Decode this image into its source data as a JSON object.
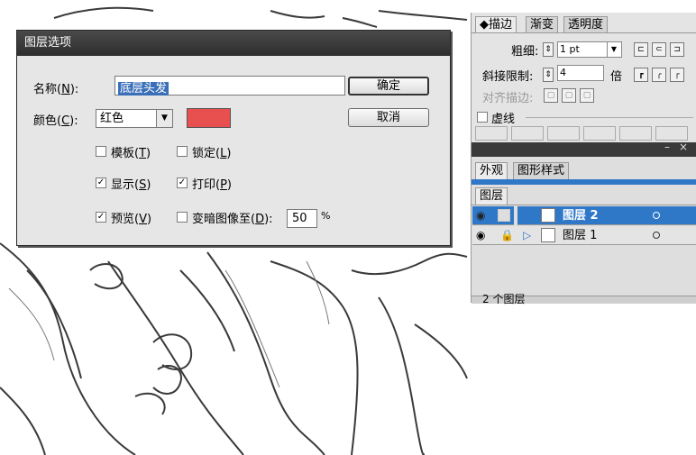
{
  "layer_options_dialog": {
    "title": "图层选项",
    "name_label": "名称(",
    "name_key": "N",
    "name_label_end": "):",
    "name_value": "底层头发",
    "color_label": "颜色(",
    "color_key": "C",
    "color_label_end": "):",
    "color_value": "红色",
    "color_swatch": "#e84f4f",
    "ok_label": "确定",
    "cancel_label": "取消",
    "template_label": "模板(",
    "template_key": "T",
    "template_end": ")",
    "template_checked": false,
    "lock_label": "锁定(",
    "lock_key": "L",
    "lock_end": ")",
    "lock_checked": false,
    "show_label": "显示(",
    "show_key": "S",
    "show_end": ")",
    "show_checked": true,
    "print_label": "打印(",
    "print_key": "P",
    "print_end": ")",
    "print_checked": true,
    "preview_label": "预览(",
    "preview_key": "V",
    "preview_end": ")",
    "preview_checked": true,
    "dim_label": "变暗图像至(",
    "dim_key": "D",
    "dim_end": "):",
    "dim_checked": false,
    "dim_value": "50",
    "dim_unit": "%"
  },
  "stroke_panel": {
    "tabs": [
      "◆描边",
      "渐变",
      "透明度"
    ],
    "weight_label": "粗细:",
    "weight_value": "1 pt",
    "miter_label": "斜接限制:",
    "miter_value": "4",
    "miter_unit": "倍",
    "align_label": "对齐描边:",
    "dashed_label": "虚线"
  },
  "layers_panel": {
    "tabs": [
      "外观",
      "图形样式"
    ],
    "title": "图层",
    "layers": [
      {
        "name": "图层 2",
        "selected": true
      },
      {
        "name": "图层 1",
        "selected": false
      }
    ],
    "footer": "2 个图层"
  }
}
